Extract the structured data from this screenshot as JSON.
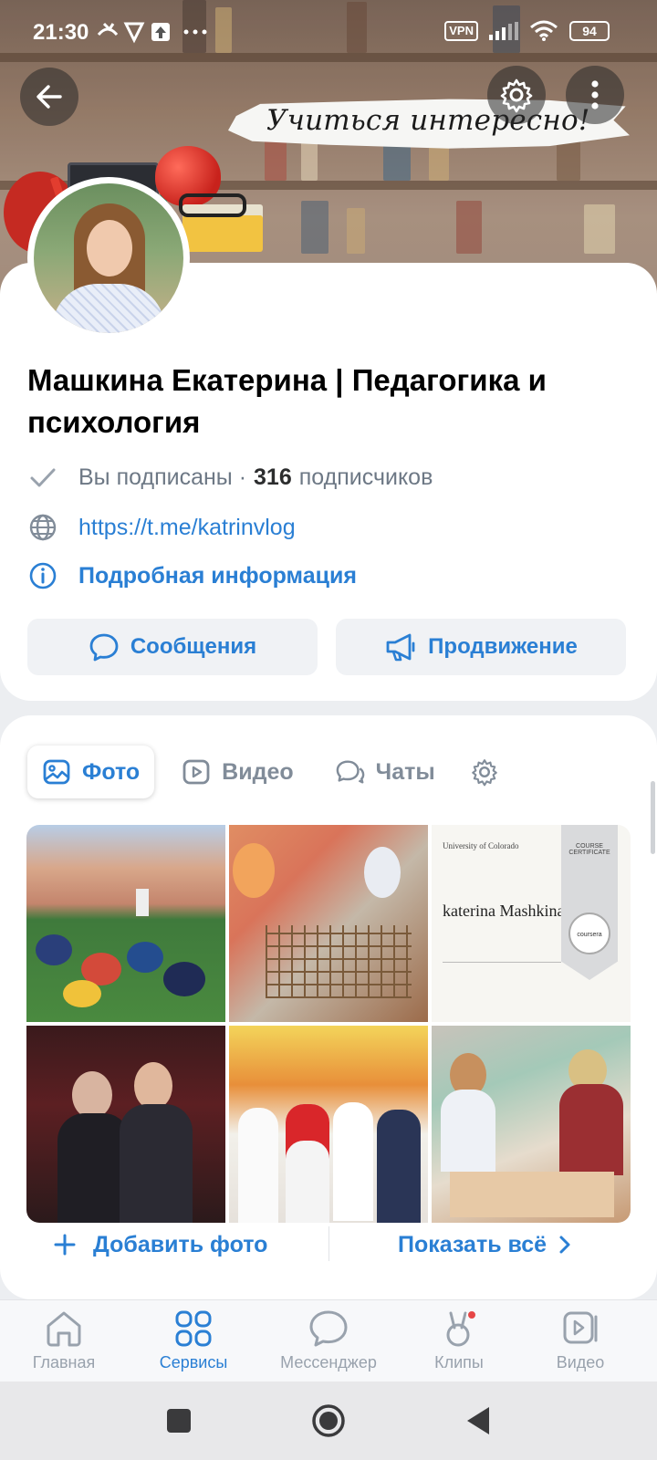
{
  "status_bar": {
    "time": "21:30",
    "left_icons": [
      "missed-call-icon",
      "vpn-shield-icon",
      "upload-icon",
      "more-dots-icon"
    ],
    "vpn_label": "VPN",
    "battery": "94"
  },
  "cover": {
    "banner_text": "Учиться интересно!"
  },
  "profile": {
    "name": "Машкина Екатерина | Педагогика и психология",
    "subscribed_text": "Вы подписаны ·",
    "subscribers_count": "316",
    "subscribers_label": "подписчиков",
    "link": "https://t.me/katrinvlog",
    "details_label": "Подробная информация",
    "buttons": {
      "messages": "Сообщения",
      "promotion": "Продвижение"
    }
  },
  "media": {
    "tabs": [
      {
        "label": "Фото",
        "active": true
      },
      {
        "label": "Видео",
        "active": false
      },
      {
        "label": "Чаты",
        "active": false
      }
    ],
    "photos_count": 6,
    "certificate": {
      "org": "University of Colorado",
      "name": "katerina Mashkina",
      "header": "COURSE CERTIFICATE",
      "brand": "coursera"
    },
    "add_photo": "Добавить фото",
    "show_all": "Показать всё"
  },
  "bottom_nav": [
    {
      "label": "Главная",
      "icon": "home-icon",
      "active": false
    },
    {
      "label": "Сервисы",
      "icon": "services-icon",
      "active": true
    },
    {
      "label": "Мессенджер",
      "icon": "messenger-icon",
      "active": false
    },
    {
      "label": "Клипы",
      "icon": "clips-icon",
      "active": false,
      "badge": true
    },
    {
      "label": "Видео",
      "icon": "video-icon",
      "active": false
    }
  ],
  "colors": {
    "accent": "#2a7fd4",
    "muted": "#818c99",
    "badge": "#e64646"
  }
}
